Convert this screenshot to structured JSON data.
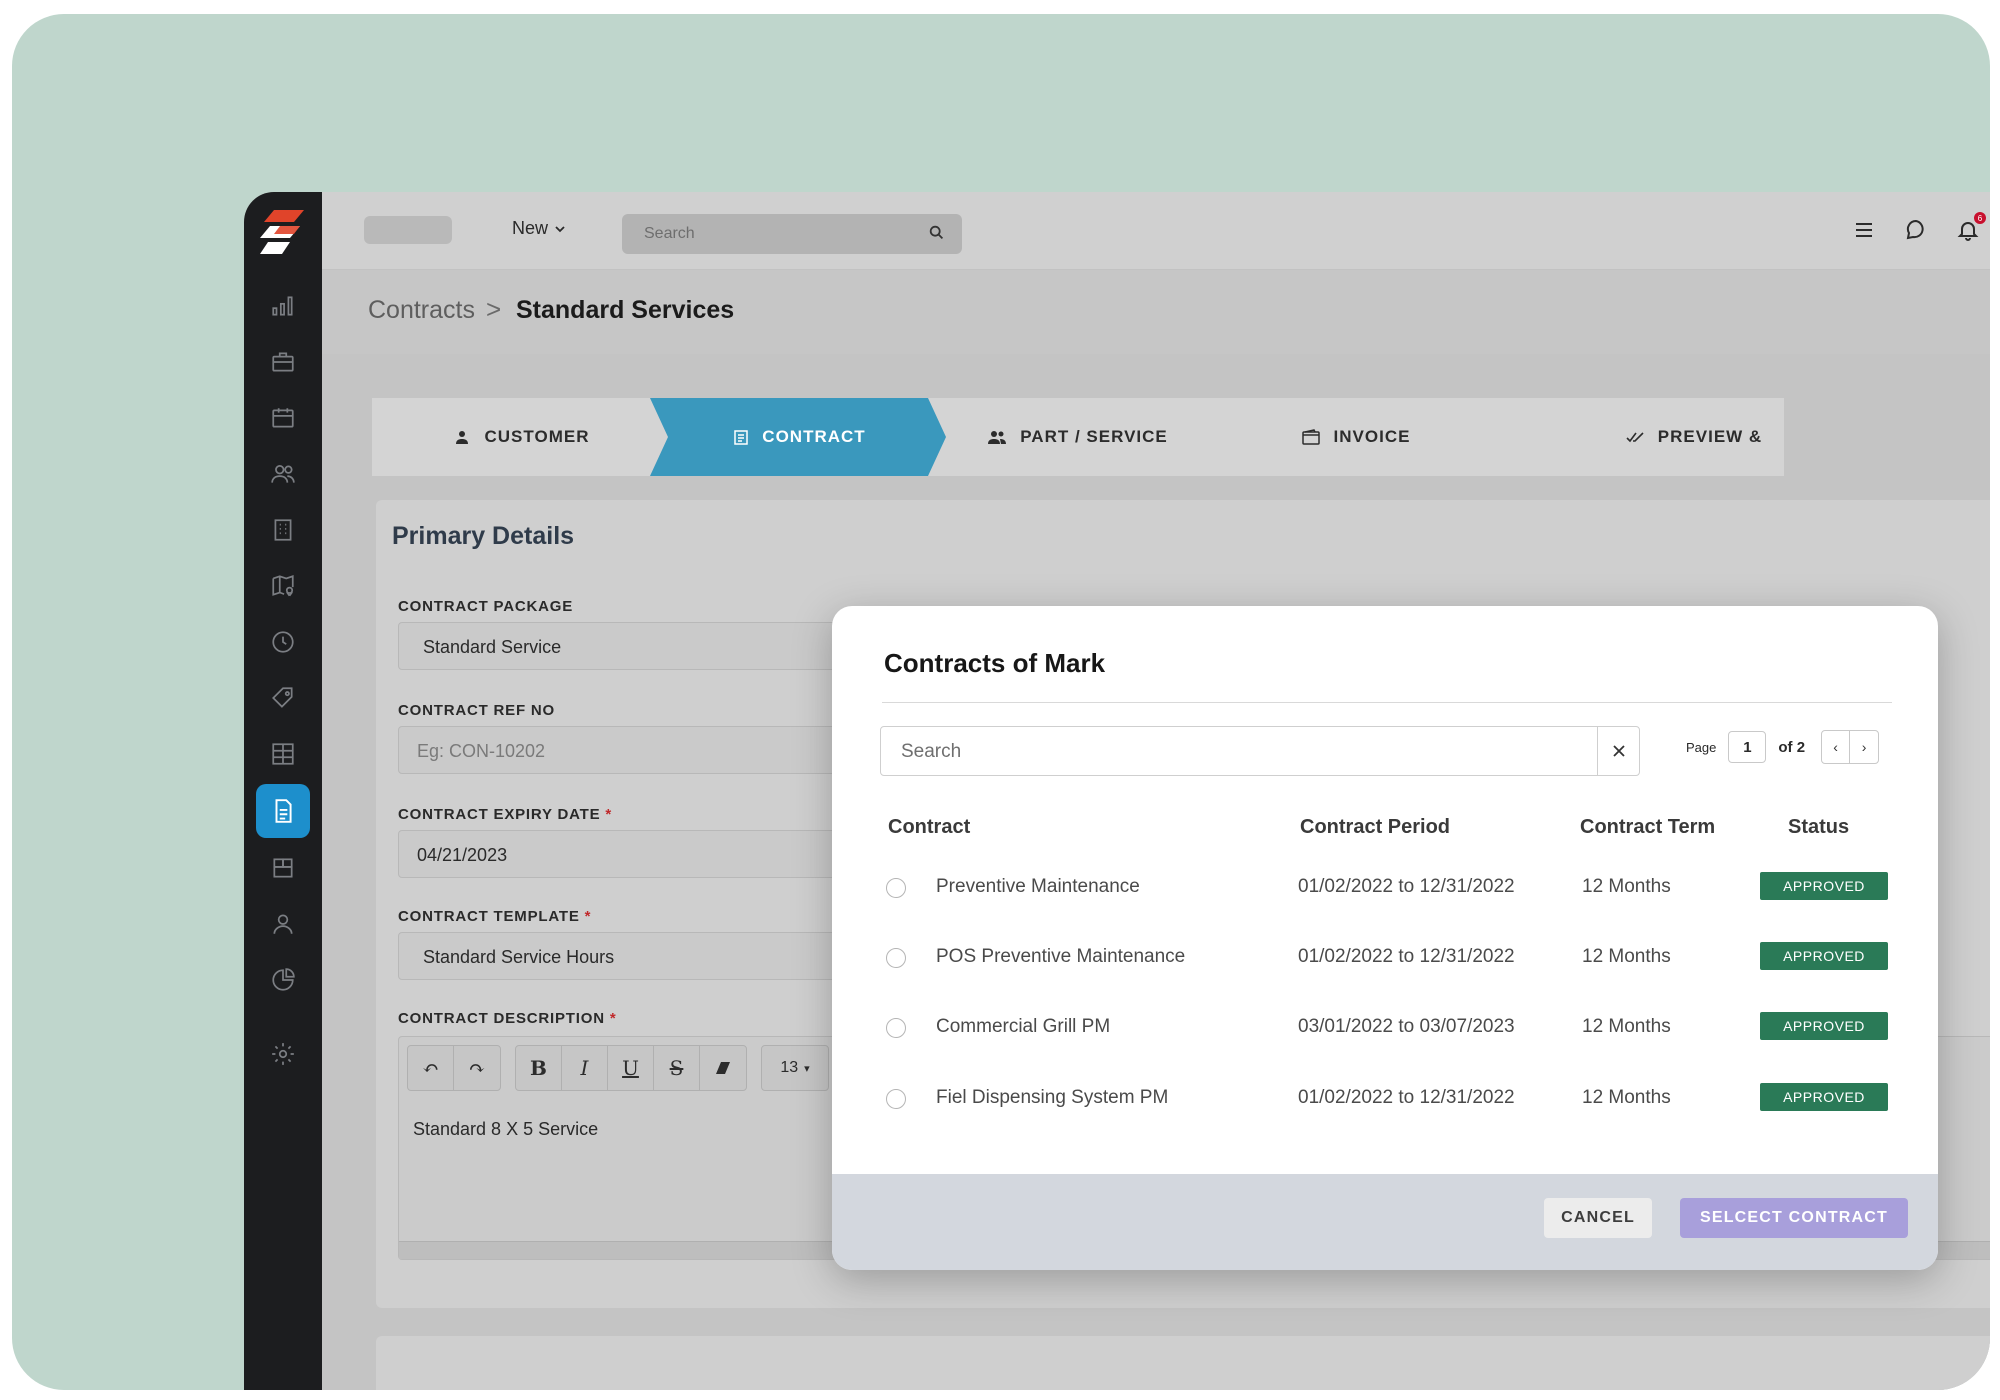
{
  "topbar": {
    "new_label": "New",
    "search_placeholder": "Search",
    "notification_count": "6"
  },
  "breadcrumb": {
    "root": "Contracts",
    "separator": ">",
    "current": "Standard Services"
  },
  "stepper": {
    "steps": [
      {
        "label": "CUSTOMER",
        "icon": "user-icon",
        "active": false
      },
      {
        "label": "CONTRACT",
        "icon": "clipboard-icon",
        "active": true
      },
      {
        "label": "PART / SERVICE",
        "icon": "users-icon",
        "active": false
      },
      {
        "label": "INVOICE",
        "icon": "wallet-icon",
        "active": false
      },
      {
        "label": "PREVIEW &",
        "icon": "double-check-icon",
        "active": false
      }
    ],
    "active_color": "#3a98bd"
  },
  "form": {
    "title": "Primary Details",
    "package_label": "CONTRACT PACKAGE",
    "package_value": "Standard Service",
    "ref_label": "CONTRACT REF NO",
    "ref_placeholder": "Eg: CON-10202",
    "expiry_label": "CONTRACT EXPIRY DATE",
    "expiry_value": "04/21/2023",
    "template_label": "CONTRACT TEMPLATE",
    "template_value": "Standard Service Hours",
    "description_label": "CONTRACT DESCRIPTION",
    "required_mark": "*",
    "editor": {
      "undo": "↶",
      "redo": "↷",
      "bold": "B",
      "italic": "I",
      "underline": "U",
      "strike": "S",
      "font_size": "13",
      "text": "Standard 8 X 5 Service"
    }
  },
  "modal": {
    "title": "Contracts of Mark",
    "search_placeholder": "Search",
    "pager": {
      "label": "Page",
      "current": "1",
      "of": "of 2",
      "prev": "‹",
      "next": "›"
    },
    "columns": [
      "Contract",
      "Contract Period",
      "Contract Term",
      "Status"
    ],
    "rows": [
      {
        "contract": "Preventive Maintenance",
        "period": "01/02/2022 to 12/31/2022",
        "term": "12 Months",
        "status": "APPROVED"
      },
      {
        "contract": "POS Preventive Maintenance",
        "period": "01/02/2022 to 12/31/2022",
        "term": "12 Months",
        "status": "APPROVED"
      },
      {
        "contract": "Commercial Grill PM",
        "period": "03/01/2022 to 03/07/2023",
        "term": "12 Months",
        "status": "APPROVED"
      },
      {
        "contract": "Fiel Dispensing System PM",
        "period": "01/02/2022 to 12/31/2022",
        "term": "12 Months",
        "status": "APPROVED"
      }
    ],
    "cancel_label": "CANCEL",
    "select_label": "SELCECT CONTRACT",
    "status_color": "#2a7a57",
    "select_color": "#a89fdb"
  },
  "sidebar": {
    "items": [
      {
        "icon": "bar-chart-icon"
      },
      {
        "icon": "briefcase-icon"
      },
      {
        "icon": "calendar-icon"
      },
      {
        "icon": "team-icon"
      },
      {
        "icon": "building-icon"
      },
      {
        "icon": "map-pin-icon"
      },
      {
        "icon": "clock-icon"
      },
      {
        "icon": "tag-icon"
      },
      {
        "icon": "grid-icon"
      },
      {
        "icon": "document-icon",
        "active": true
      },
      {
        "icon": "inventory-icon"
      },
      {
        "icon": "person-icon"
      },
      {
        "icon": "pie-chart-icon"
      },
      {
        "icon": "gear-icon"
      }
    ],
    "active_color": "#1d8fcc"
  }
}
